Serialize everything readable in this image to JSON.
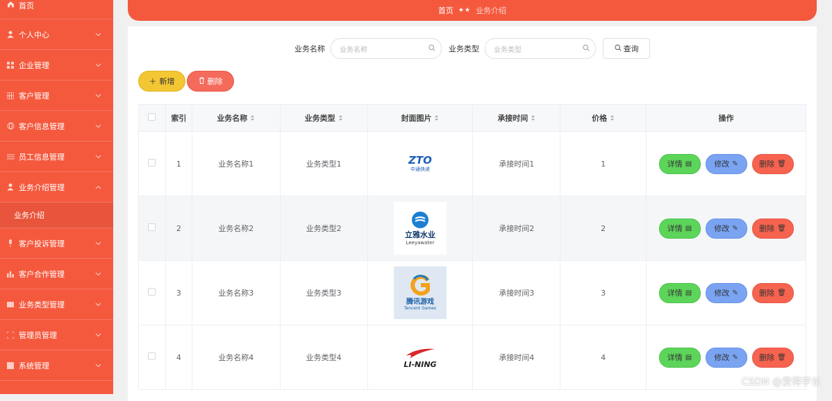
{
  "sidebar": {
    "items": [
      {
        "label": "首页",
        "icon": "home-icon"
      },
      {
        "label": "个人中心",
        "icon": "user-icon"
      },
      {
        "label": "企业管理",
        "icon": "grid-icon"
      },
      {
        "label": "客户管理",
        "icon": "grid9-icon"
      },
      {
        "label": "客户信息管理",
        "icon": "globe-icon"
      },
      {
        "label": "员工信息管理",
        "icon": "sliders-icon"
      },
      {
        "label": "业务介绍管理",
        "icon": "user-icon"
      },
      {
        "label": "客户投诉管理",
        "icon": "mic-icon"
      },
      {
        "label": "客户合作管理",
        "icon": "chart-icon"
      },
      {
        "label": "业务类型管理",
        "icon": "rect-icon"
      },
      {
        "label": "管理员管理",
        "icon": "frame-icon"
      },
      {
        "label": "系统管理",
        "icon": "box-icon"
      }
    ],
    "submenu_label": "业务介绍"
  },
  "breadcrumb": {
    "home": "首页",
    "separator": "★★",
    "current": "业务介绍"
  },
  "search": {
    "name_label": "业务名称",
    "name_placeholder": "业务名称",
    "type_label": "业务类型",
    "type_placeholder": "业务类型",
    "query_label": "查询"
  },
  "toolbar": {
    "add_label": "新增",
    "delete_label": "删除"
  },
  "table": {
    "headers": [
      "索引",
      "业务名称",
      "业务类型",
      "封面图片",
      "承接时间",
      "价格",
      "操作"
    ],
    "rows": [
      {
        "index": "1",
        "name": "业务名称1",
        "type": "业务类型1",
        "logo": "zto-logo",
        "time": "承接时间1",
        "price": "1"
      },
      {
        "index": "2",
        "name": "业务名称2",
        "type": "业务类型2",
        "logo": "leeyawater-logo",
        "time": "承接时间2",
        "price": "2"
      },
      {
        "index": "3",
        "name": "业务名称3",
        "type": "业务类型3",
        "logo": "tencent-games-logo",
        "time": "承接时间3",
        "price": "3"
      },
      {
        "index": "4",
        "name": "业务名称4",
        "type": "业务类型4",
        "logo": "li-ning-logo",
        "time": "承接时间4",
        "price": "4"
      }
    ],
    "op_detail": "详情",
    "op_edit": "修改",
    "op_delete": "删除"
  },
  "logo_text": {
    "zto": "ZTO",
    "zto_cn": "中通快递",
    "leeya_cn": "立雅水业",
    "leeya_en": "Leeyawater",
    "tencent_cn": "腾讯游戏",
    "tencent_en": "Tencent Games",
    "lining": "LI-NING"
  },
  "watermark": "CSDN @爱得学长",
  "colors": {
    "brand": "#f4593e",
    "add": "#f3c633",
    "detail": "#5dd45a",
    "edit": "#7aa4f2",
    "delete": "#f6634f"
  }
}
